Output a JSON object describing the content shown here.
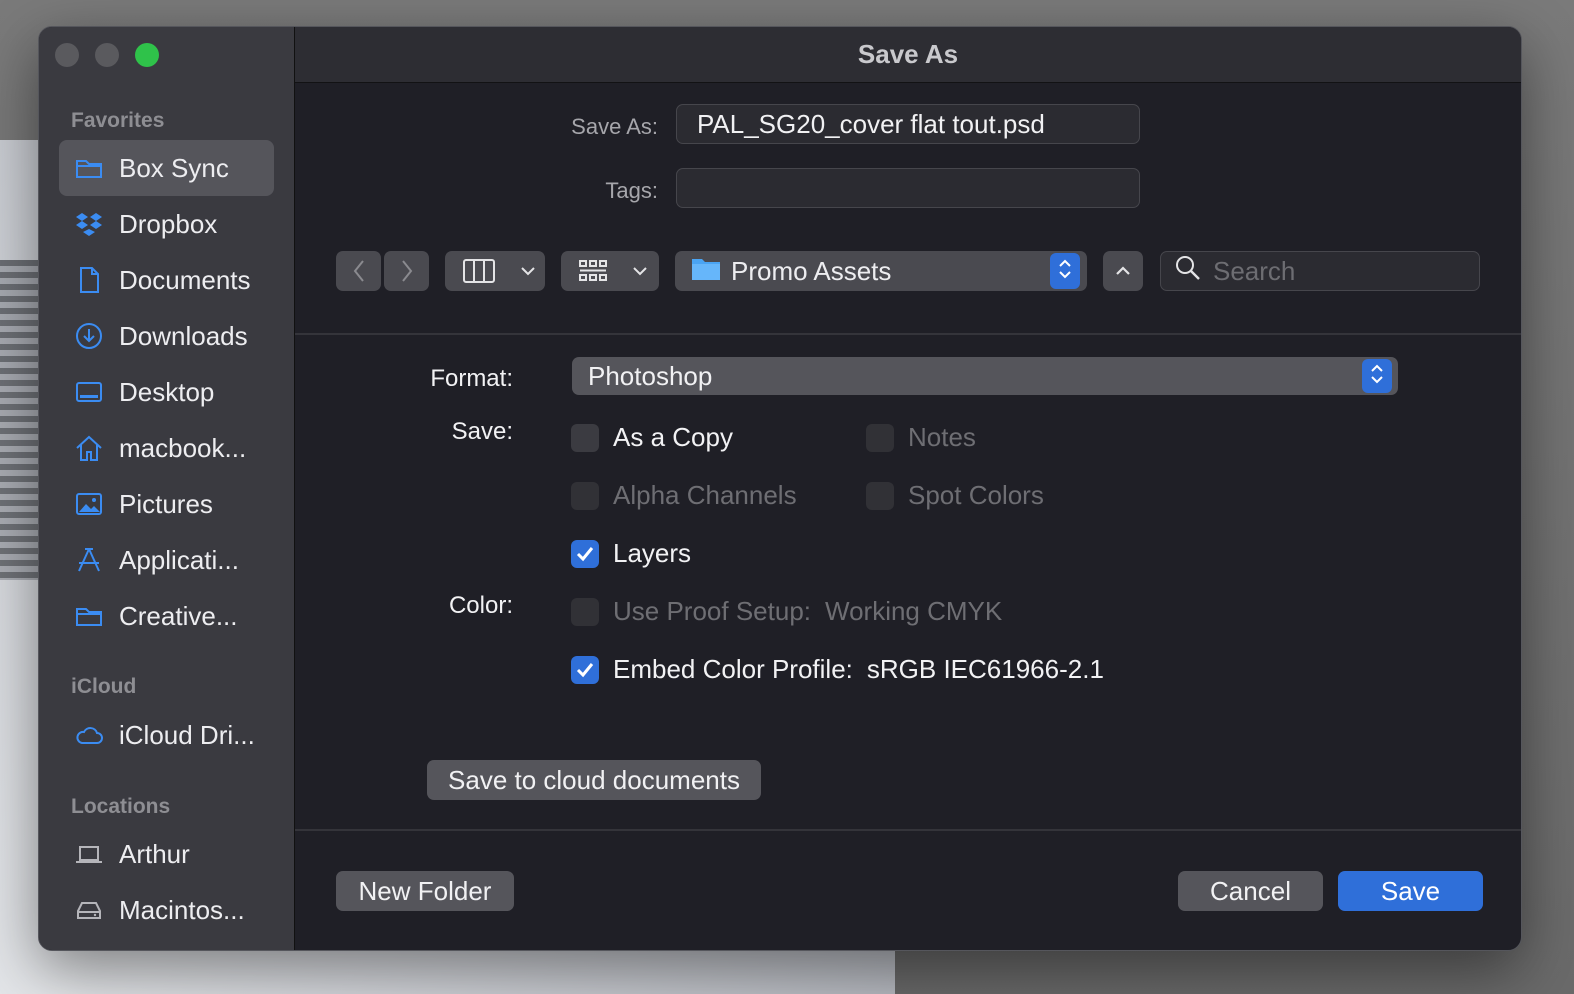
{
  "dialog": {
    "title": "Save As"
  },
  "sidebar": {
    "favorites_title": "Favorites",
    "favorites": [
      {
        "label": "Box Sync",
        "icon": "folder-icon"
      },
      {
        "label": "Dropbox",
        "icon": "dropbox-icon"
      },
      {
        "label": "Documents",
        "icon": "document-icon"
      },
      {
        "label": "Downloads",
        "icon": "download-icon"
      },
      {
        "label": "Desktop",
        "icon": "desktop-icon"
      },
      {
        "label": "macbook...",
        "icon": "home-icon"
      },
      {
        "label": "Pictures",
        "icon": "pictures-icon"
      },
      {
        "label": "Applicati...",
        "icon": "applications-icon"
      },
      {
        "label": "Creative...",
        "icon": "folder-icon"
      }
    ],
    "icloud_title": "iCloud",
    "icloud": [
      {
        "label": "iCloud Dri...",
        "icon": "cloud-icon"
      }
    ],
    "locations_title": "Locations",
    "locations": [
      {
        "label": "Arthur",
        "icon": "laptop-icon"
      },
      {
        "label": "Macintos...",
        "icon": "disk-icon"
      }
    ]
  },
  "fields": {
    "save_as_label": "Save As:",
    "save_as_value": "PAL_SG20_cover flat tout.psd",
    "tags_label": "Tags:",
    "tags_value": ""
  },
  "toolbar": {
    "location": "Promo Assets",
    "search_placeholder": "Search"
  },
  "options": {
    "format_label": "Format:",
    "format_value": "Photoshop",
    "save_label": "Save:",
    "color_label": "Color:",
    "as_a_copy": {
      "label": "As a Copy",
      "checked": false
    },
    "notes": {
      "label": "Notes",
      "checked": false
    },
    "alpha_channels": {
      "label": "Alpha Channels",
      "checked": false
    },
    "spot_colors": {
      "label": "Spot Colors",
      "checked": false
    },
    "layers": {
      "label": "Layers",
      "checked": true
    },
    "use_proof_setup": {
      "label": "Use Proof Setup:",
      "value": "Working CMYK",
      "checked": false
    },
    "embed_color_profile": {
      "label": "Embed Color Profile:",
      "value": "sRGB IEC61966-2.1",
      "checked": true
    },
    "cloud_button": "Save to cloud documents"
  },
  "footer": {
    "new_folder": "New Folder",
    "cancel": "Cancel",
    "save": "Save"
  },
  "colors": {
    "accent": "#2f6fd9",
    "sidebar_icon": "#3b8cf2"
  }
}
